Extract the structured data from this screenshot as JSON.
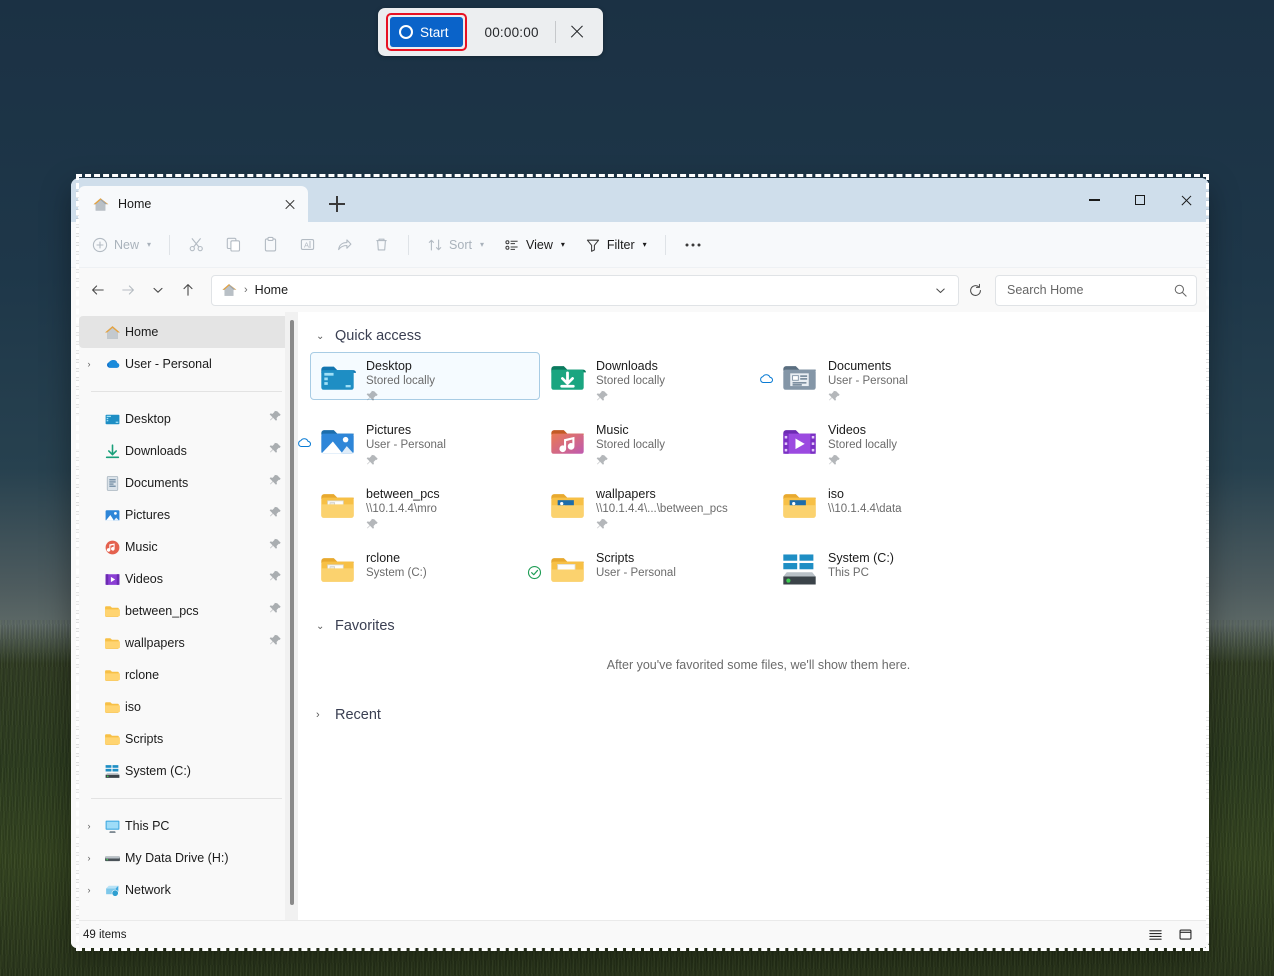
{
  "recorder": {
    "start_label": "Start",
    "timer": "00:00:00",
    "close_label": "Close",
    "accent_blue": "#0a63c9",
    "highlight_red": "#e81123"
  },
  "window": {
    "tab_title": "Home",
    "new_tab_label": "New tab",
    "minimize_label": "Minimize",
    "maximize_label": "Maximize",
    "close_label": "Close"
  },
  "toolbar": {
    "new_label": "New",
    "cut_label": "Cut",
    "copy_label": "Copy",
    "paste_label": "Paste",
    "rename_label": "Rename",
    "share_label": "Share",
    "delete_label": "Delete",
    "sort_label": "Sort",
    "view_label": "View",
    "filter_label": "Filter",
    "more_label": "See more"
  },
  "addressbar": {
    "back_label": "Back",
    "forward_label": "Forward",
    "recent_label": "Recent locations",
    "up_label": "Up",
    "crumb": "Home",
    "crumb_sep": "›",
    "refresh_label": "Refresh"
  },
  "search": {
    "placeholder": "Search Home"
  },
  "sidebar": {
    "groups": [
      {
        "items": [
          {
            "label": "Home",
            "icon": "home-icon",
            "selected": true,
            "expandable": false,
            "pinned": false
          },
          {
            "label": "User - Personal",
            "icon": "onedrive-icon",
            "selected": false,
            "expandable": true,
            "pinned": false
          }
        ]
      },
      {
        "items": [
          {
            "label": "Desktop",
            "icon": "desktop-icon",
            "selected": false,
            "expandable": false,
            "pinned": true
          },
          {
            "label": "Downloads",
            "icon": "downloads-icon",
            "selected": false,
            "expandable": false,
            "pinned": true
          },
          {
            "label": "Documents",
            "icon": "documents-icon",
            "selected": false,
            "expandable": false,
            "pinned": true
          },
          {
            "label": "Pictures",
            "icon": "pictures-icon",
            "selected": false,
            "expandable": false,
            "pinned": true
          },
          {
            "label": "Music",
            "icon": "music-icon",
            "selected": false,
            "expandable": false,
            "pinned": true
          },
          {
            "label": "Videos",
            "icon": "videos-icon",
            "selected": false,
            "expandable": false,
            "pinned": true
          },
          {
            "label": "between_pcs",
            "icon": "folder-icon",
            "selected": false,
            "expandable": false,
            "pinned": true
          },
          {
            "label": "wallpapers",
            "icon": "folder-icon",
            "selected": false,
            "expandable": false,
            "pinned": true
          },
          {
            "label": "rclone",
            "icon": "folder-icon",
            "selected": false,
            "expandable": false,
            "pinned": false
          },
          {
            "label": "iso",
            "icon": "folder-icon",
            "selected": false,
            "expandable": false,
            "pinned": false
          },
          {
            "label": "Scripts",
            "icon": "folder-icon",
            "selected": false,
            "expandable": false,
            "pinned": false
          },
          {
            "label": "System (C:)",
            "icon": "windows-drive-icon",
            "selected": false,
            "expandable": false,
            "pinned": false
          }
        ]
      },
      {
        "items": [
          {
            "label": "This PC",
            "icon": "this-pc-icon",
            "selected": false,
            "expandable": true,
            "pinned": false
          },
          {
            "label": "My Data Drive (H:)",
            "icon": "drive-icon",
            "selected": false,
            "expandable": true,
            "pinned": false
          },
          {
            "label": "Network",
            "icon": "network-icon",
            "selected": false,
            "expandable": true,
            "pinned": false
          }
        ]
      }
    ]
  },
  "main": {
    "quick_access": {
      "title": "Quick access",
      "expanded": true,
      "tiles": [
        {
          "name": "Desktop",
          "sub": "Stored locally",
          "icon": "desktop-folder-icon",
          "pinned": true,
          "badge": "",
          "selected": true
        },
        {
          "name": "Downloads",
          "sub": "Stored locally",
          "icon": "downloads-folder-icon",
          "pinned": true,
          "badge": "",
          "selected": false
        },
        {
          "name": "Documents",
          "sub": "User - Personal",
          "icon": "documents-folder-icon",
          "pinned": true,
          "badge": "cloud",
          "selected": false
        },
        {
          "name": "Pictures",
          "sub": "User - Personal",
          "icon": "pictures-folder-icon",
          "pinned": true,
          "badge": "cloud",
          "selected": false
        },
        {
          "name": "Music",
          "sub": "Stored locally",
          "icon": "music-folder-icon",
          "pinned": true,
          "badge": "",
          "selected": false
        },
        {
          "name": "Videos",
          "sub": "Stored locally",
          "icon": "videos-folder-icon",
          "pinned": true,
          "badge": "",
          "selected": false
        },
        {
          "name": "between_pcs",
          "sub": "\\\\10.1.4.4\\mro",
          "icon": "folder-doc-icon",
          "pinned": true,
          "badge": "",
          "selected": false
        },
        {
          "name": "wallpapers",
          "sub": "\\\\10.1.4.4\\...\\between_pcs",
          "icon": "folder-pic-icon",
          "pinned": true,
          "badge": "",
          "selected": false
        },
        {
          "name": "iso",
          "sub": "\\\\10.1.4.4\\data",
          "icon": "folder-pic-icon",
          "pinned": false,
          "badge": "",
          "selected": false
        },
        {
          "name": "rclone",
          "sub": "System (C:)",
          "icon": "folder-doc-icon",
          "pinned": false,
          "badge": "",
          "selected": false
        },
        {
          "name": "Scripts",
          "sub": "User - Personal",
          "icon": "folder-plain-icon",
          "pinned": false,
          "badge": "check",
          "selected": false
        },
        {
          "name": "System (C:)",
          "sub": "This PC",
          "icon": "windows-drive-big-icon",
          "pinned": false,
          "badge": "",
          "selected": false
        }
      ]
    },
    "favorites": {
      "title": "Favorites",
      "expanded": true,
      "empty_text": "After you've favorited some files, we'll show them here."
    },
    "recent": {
      "title": "Recent",
      "expanded": false
    }
  },
  "statusbar": {
    "items_count": "49 items",
    "details_view_label": "Details view",
    "icons_view_label": "Large icons view"
  }
}
